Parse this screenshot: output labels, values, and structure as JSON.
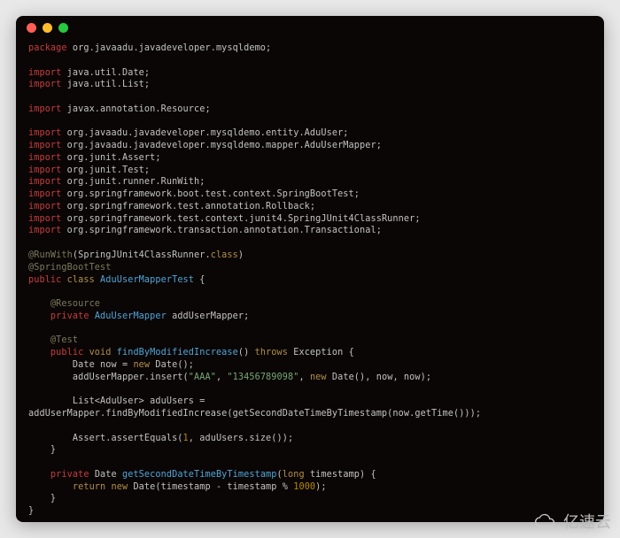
{
  "watermark_text": "亿速云",
  "code": {
    "l01_kw": "package",
    "l01_pkg": " org.javaadu.javadeveloper.mysqldemo;",
    "l02_kw": "import",
    "l02_pkg": " java.util.Date;",
    "l03_kw": "import",
    "l03_pkg": " java.util.List;",
    "l04_kw": "import",
    "l04_pkg": " javax.annotation.Resource;",
    "l05_kw": "import",
    "l05_pkg": " org.javaadu.javadeveloper.mysqldemo.entity.AduUser;",
    "l06_kw": "import",
    "l06_pkg": " org.javaadu.javadeveloper.mysqldemo.mapper.AduUserMapper;",
    "l07_kw": "import",
    "l07_pkg": " org.junit.Assert;",
    "l08_kw": "import",
    "l08_pkg": " org.junit.Test;",
    "l09_kw": "import",
    "l09_pkg": " org.junit.runner.RunWith;",
    "l10_kw": "import",
    "l10_pkg": " org.springframework.boot.test.context.SpringBootTest;",
    "l11_kw": "import",
    "l11_pkg": " org.springframework.test.annotation.Rollback;",
    "l12_kw": "import",
    "l12_pkg": " org.springframework.test.context.junit4.SpringJUnit4ClassRunner;",
    "l13_kw": "import",
    "l13_pkg": " org.springframework.transaction.annotation.Transactional;",
    "l14_ann": "@RunWith",
    "l14_op": "(",
    "l14_cls": "SpringJUnit4ClassRunner",
    "l14_dot": ".",
    "l14_class": "class",
    "l14_cp": ")",
    "l15_ann": "@SpringBootTest",
    "l16_mod": "public ",
    "l16_cls": "class",
    "l16_name": " AduUserMapperTest ",
    "l16_ob": "{",
    "l17_ann": "    @Resource",
    "l18_mod": "    private ",
    "l18_typ": "AduUserMapper",
    "l18_var": " addUserMapper;",
    "l19_ann": "    @Test",
    "l20_mod": "    public ",
    "l20_ret": "void ",
    "l20_name": "findByModifiedIncrease",
    "l20_p": "() ",
    "l20_thr": "throws",
    "l20_exc": " Exception {",
    "l21_typ": "        Date ",
    "l21_var": "now = ",
    "l21_new": "new ",
    "l21_call": "Date();",
    "l22_call": "        addUserMapper.insert(",
    "l22_s1": "\"AAA\"",
    "l22_c1": ", ",
    "l22_s2": "\"13456789098\"",
    "l22_c2": ", ",
    "l22_new": "new ",
    "l22_d": "Date(), now, now);",
    "l23_typ": "        List<AduUser> ",
    "l23_var": "aduUsers =",
    "l24_call": "addUserMapper.findByModifiedIncrease(getSecondDateTimeByTimestamp(now.getTime()));",
    "l25_call": "        Assert.assertEquals(",
    "l25_num": "1",
    "l25_rest": ", aduUsers.size());",
    "l26_cb": "    }",
    "l27_mod": "    private ",
    "l27_ret": "Date ",
    "l27_name": "getSecondDateTimeByTimestamp",
    "l27_p": "(",
    "l27_pt": "long ",
    "l27_pv": "timestamp) {",
    "l28_ret": "        return ",
    "l28_new": "new ",
    "l28_call": "Date(timestamp - timestamp % ",
    "l28_num": "1000",
    "l28_end": ");",
    "l29_cb": "    }",
    "l30_cb": "}"
  }
}
